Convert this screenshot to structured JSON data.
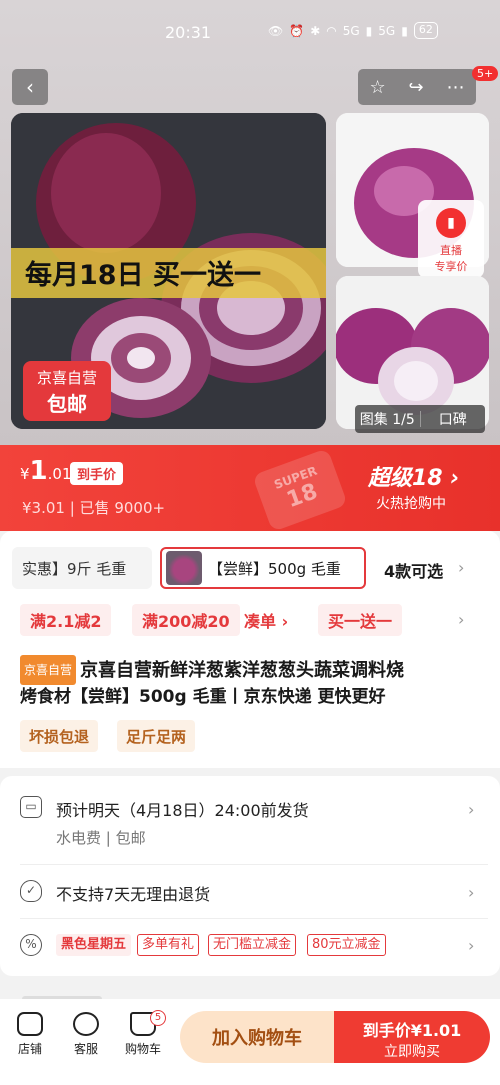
{
  "status_bar": {
    "time": "20:31",
    "battery": "62",
    "signal_1": "5G",
    "signal_2": "5G"
  },
  "header": {
    "back": "‹",
    "notification_count": "5+"
  },
  "gallery": {
    "promo_text": "每月18日 买一送一",
    "store_tag_line1": "京喜自营",
    "store_tag_line2": "包邮",
    "live_label_1": "直播",
    "live_label_2": "专享价",
    "counter": "图集 1/5",
    "reviews": "口碑"
  },
  "price": {
    "currency": "¥",
    "integer": "1",
    "decimal": ".01",
    "tag": "到手价",
    "original": "¥3.01",
    "sold": "已售 9000+",
    "super_title": "超级18",
    "super_sub": "火热抢购中",
    "super_watermark_1": "SUPER",
    "super_watermark_2": "18"
  },
  "variants": {
    "option_1": "实惠】9斤 毛重",
    "option_2": "【尝鲜】500g 毛重",
    "count": "4款可选"
  },
  "promos": [
    "满2.1减2",
    "满200减20",
    "凑单 ›",
    "买一送一"
  ],
  "product": {
    "store_badge": "京喜自营",
    "title_line1": "京喜自营新鲜洋葱紫洋葱葱头蔬菜调料烧",
    "title_line2": "烤食材【尝鲜】500g 毛重丨京东快递 更快更好",
    "features": [
      "坏损包退",
      "足斤足两"
    ]
  },
  "info": {
    "shipping": "预计明天（4月18日）24:00前发货",
    "shipping_sub_1": "水电费",
    "shipping_sub_2": "包邮",
    "return_policy": "不支持7天无理由退货",
    "event_tags": [
      "黑色星期五",
      "多单有礼",
      "无门槛立减金",
      "80元立减金"
    ]
  },
  "bottom_bar": {
    "store": "店铺",
    "service": "客服",
    "cart": "购物车",
    "cart_count": "5",
    "add_to_cart": "加入购物车",
    "buy_line1": "到手价¥1.01",
    "buy_line2": "立即购买"
  },
  "colors": {
    "brand_red": "#e4393c",
    "price_bar": "#ef3b32",
    "cart_button": "#fde3c9"
  }
}
